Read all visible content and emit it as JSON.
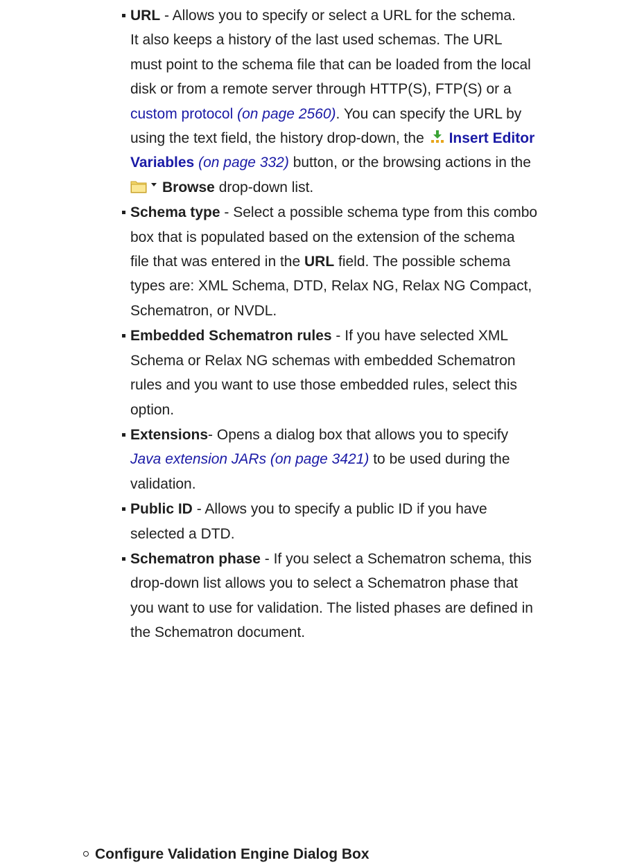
{
  "items": {
    "url": {
      "term": "URL",
      "text1": " - Allows you to specify or select a URL for the schema.",
      "text2": "It also keeps a history of the last used schemas. The URL",
      "text3": "must point to the schema file that can be loaded from the local",
      "text4": "disk or from a remote server through HTTP(S), FTP(S) or a",
      "custom_protocol_link": "custom protocol",
      "custom_protocol_ref": "(on page 2560)",
      "text5": ". You can specify the URL by",
      "text6": "using the text field, the history drop-down, the ",
      "insert_vars_link_1": "Insert Editor",
      "insert_vars_link_2": "Variables",
      "insert_vars_ref": "(on page 332)",
      "text7": " button, or the browsing actions in the",
      "browse_label": "Browse",
      "text8": " drop-down list."
    },
    "schema_type": {
      "term": "Schema type",
      "text1": " - Select a possible schema type from this combo",
      "text2": "box that is populated based on the extension of the schema",
      "text3": "file that was entered in the ",
      "url_term": "URL",
      "text4": " field. The possible schema",
      "text5": "types are: XML Schema, DTD, Relax NG, Relax NG Compact,",
      "text6": "Schematron, or NVDL."
    },
    "embedded": {
      "term": "Embedded Schematron rules",
      "text1": " - If you have selected XML",
      "text2": "Schema or Relax NG schemas with embedded Schematron",
      "text3": "rules and you want to use those embedded rules, select this",
      "text4": "option."
    },
    "extensions": {
      "term": "Extensions",
      "text1": "- Opens a dialog box that allows you to specify",
      "java_link": "Java extension JARs (on page 3421)",
      "text2": " to be used during the",
      "text3": "validation."
    },
    "public_id": {
      "term": "Public ID",
      "text1": " - Allows you to specify a public ID if you have",
      "text2": "selected a DTD."
    },
    "phase": {
      "term": "Schematron phase",
      "text1": " - If you select a Schematron schema, this",
      "text2": "drop-down list allows you to select a Schematron phase that",
      "text3": "you want to use for validation. The listed phases are defined in",
      "text4": "the Schematron document."
    }
  },
  "next_section": {
    "title": "Configure Validation Engine Dialog Box"
  },
  "icons": {
    "insert_editor_variables": "insert-variables-icon",
    "browse_folder": "folder-icon",
    "dropdown": "caret-down-icon"
  },
  "colors": {
    "link": "#1a1aa6",
    "text": "#1f1f1f",
    "insert_icon_green": "#3aa335",
    "insert_icon_orange": "#e7a51c",
    "folder_yellow": "#f3d66b"
  }
}
